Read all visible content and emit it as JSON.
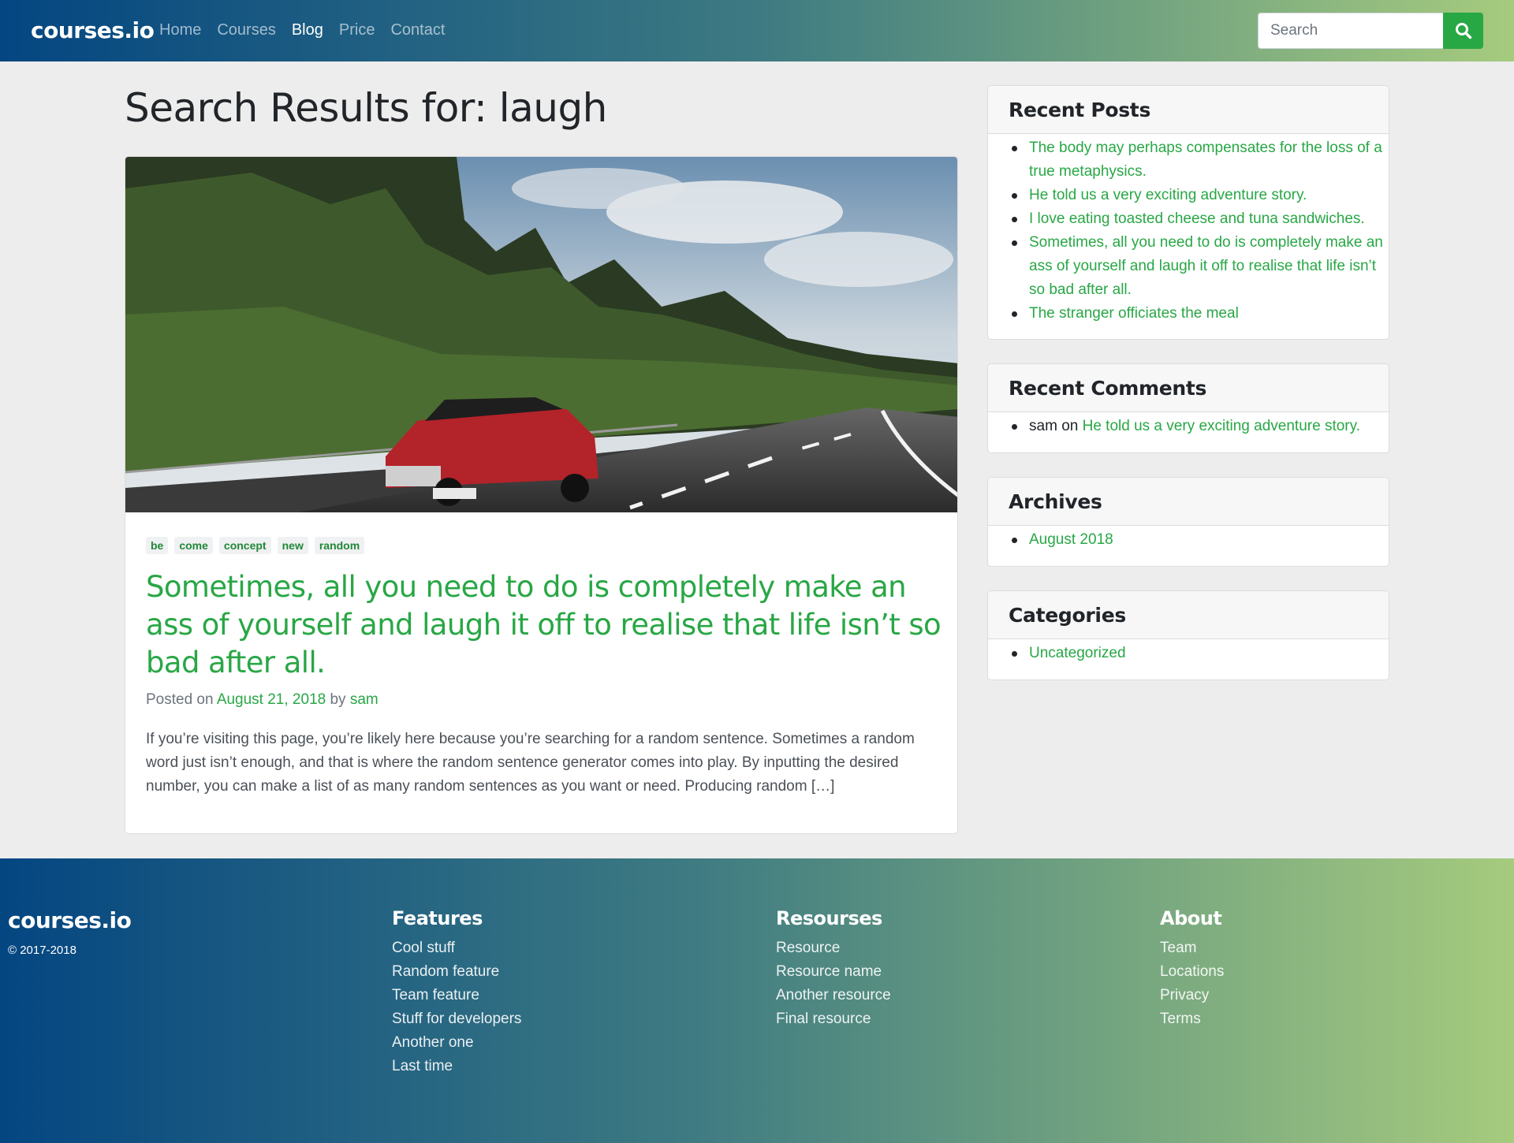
{
  "navbar": {
    "brand": "courses.io",
    "links": [
      {
        "label": "Home",
        "active": false
      },
      {
        "label": "Courses",
        "active": false
      },
      {
        "label": "Blog",
        "active": true
      },
      {
        "label": "Price",
        "active": false
      },
      {
        "label": "Contact",
        "active": false
      }
    ],
    "search_placeholder": "Search",
    "search_icon": "search-icon"
  },
  "colors": {
    "accent": "#28a745",
    "gradient_start": "#044681",
    "gradient_end": "#a6cb7e"
  },
  "main": {
    "heading": "Search Results for: laugh",
    "post": {
      "tags": [
        "be",
        "come",
        "concept",
        "new",
        "random"
      ],
      "title": "Sometimes, all you need to do is completely make an ass of yourself and laugh it off to realise that life isn’t so bad after all.",
      "meta_prefix": "Posted on",
      "date": "August 21, 2018",
      "meta_by": "by",
      "author": "sam",
      "excerpt": "If you’re visiting this page, you’re likely here because you’re searching for a random sentence. Sometimes a random word just isn’t enough, and that is where the random sentence generator comes into play. By inputting the desired number, you can make a list of as many random sentences as you want or need. Producing random […]"
    }
  },
  "sidebar": {
    "recent_posts": {
      "title": "Recent Posts",
      "items": [
        "The body may perhaps compensates for the loss of a true metaphysics.",
        "He told us a very exciting adventure story.",
        "I love eating toasted cheese and tuna sandwiches.",
        "Sometimes, all you need to do is completely make an ass of yourself and laugh it off to realise that life isn’t so bad after all.",
        "The stranger officiates the meal"
      ]
    },
    "recent_comments": {
      "title": "Recent Comments",
      "author": "sam",
      "on": "on",
      "link": "He told us a very exciting adventure story."
    },
    "archives": {
      "title": "Archives",
      "items": [
        "August 2018"
      ]
    },
    "categories": {
      "title": "Categories",
      "items": [
        "Uncategorized"
      ]
    }
  },
  "footer": {
    "brand": "courses.io",
    "copyright": "© 2017-2018",
    "columns": [
      {
        "title": "Features",
        "items": [
          "Cool stuff",
          "Random feature",
          "Team feature",
          "Stuff for developers",
          "Another one",
          "Last time"
        ]
      },
      {
        "title": "Resourses",
        "items": [
          "Resource",
          "Resource name",
          "Another resource",
          "Final resource"
        ]
      },
      {
        "title": "About",
        "items": [
          "Team",
          "Locations",
          "Privacy",
          "Terms"
        ]
      }
    ]
  }
}
